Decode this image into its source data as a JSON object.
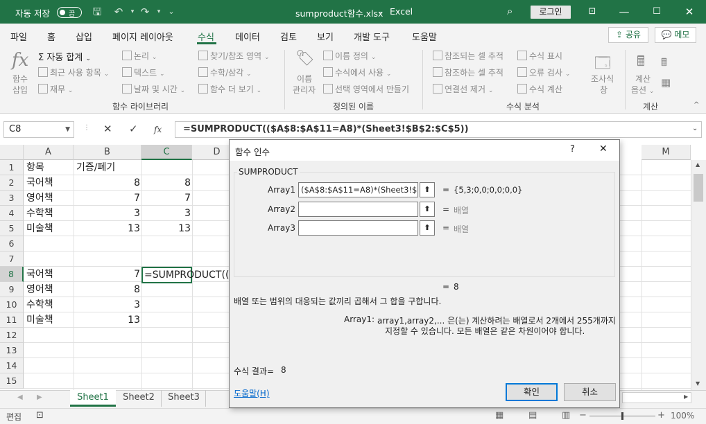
{
  "titlebar": {
    "autosave_label": "자동 저장",
    "autosave_state": "끔",
    "filename": "sumproduct함수.xlsx",
    "separator": "-",
    "app": "Excel",
    "login_label": "로그인",
    "bg_color": "#217346"
  },
  "menu": {
    "tabs": [
      "파일",
      "홈",
      "삽입",
      "페이지 레이아웃",
      "수식",
      "데이터",
      "검토",
      "보기",
      "개발 도구",
      "도움말"
    ],
    "active_tab": "수식",
    "share_label": "공유",
    "memo_label": "메모"
  },
  "ribbon": {
    "fx_label_1": "함수",
    "fx_label_2": "삽입",
    "autosum_label": "자동 합계",
    "recent_label": "최근 사용 항목",
    "finance_label": "재무",
    "logical_label": "논리",
    "text_label": "텍스트",
    "datetime_label": "날짜 및 시간",
    "lookup_label": "찾기/참조 영역",
    "math_label": "수학/삼각",
    "more_label": "함수 더 보기",
    "group1": "함수 라이브러리",
    "name_mgr_1": "이름",
    "name_mgr_2": "관리자",
    "define_name": "이름 정의",
    "use_in_formula": "수식에서 사용",
    "create_from_sel": "선택 영역에서 만들기",
    "group2": "정의된 이름",
    "trace_prec": "참조되는 셀 추적",
    "trace_dep": "참조하는 셀 추적",
    "remove_arrows": "연결선 제거",
    "show_formulas": "수식 표시",
    "error_check": "오류 검사",
    "eval_formula": "수식 계산",
    "watch_1": "조사식",
    "watch_2": "창",
    "group3": "수식 분석",
    "calc_opt_1": "계산",
    "calc_opt_2": "옵션",
    "group4": "계산"
  },
  "formula_bar": {
    "name_box": "C8",
    "cancel_icon": "✕",
    "enter_icon": "✓",
    "fx_icon": "fx",
    "formula": "=SUMPRODUCT(($A$8:$A$11=A8)*(Sheet3!$B$2:$C$5))"
  },
  "grid": {
    "columns": [
      "A",
      "B",
      "C",
      "D",
      "E",
      "F",
      "G",
      "H",
      "I",
      "J",
      "K",
      "L",
      "M"
    ],
    "rows": [
      "1",
      "2",
      "3",
      "4",
      "5",
      "6",
      "7",
      "8",
      "9",
      "10",
      "11",
      "12",
      "13",
      "14",
      "15"
    ],
    "cells": {
      "A1": "항목",
      "B1": "기증/폐기",
      "A2": "국어책",
      "B2": "8",
      "C2": "8",
      "A3": "영어책",
      "B3": "7",
      "C3": "7",
      "A4": "수학책",
      "B4": "3",
      "C4": "3",
      "A5": "미술책",
      "B5": "13",
      "C5": "13",
      "A8": "국어책",
      "B8": "7",
      "C8": "=SUMPRODUCT((",
      "A9": "영어책",
      "B9": "8",
      "A10": "수학책",
      "B10": "3",
      "A11": "미술책",
      "B11": "13"
    }
  },
  "sheets": {
    "tabs": [
      "Sheet1",
      "Sheet2",
      "Sheet3"
    ],
    "active": "Sheet1"
  },
  "status": {
    "mode": "편집",
    "zoom": "100%"
  },
  "dialog": {
    "title": "함수 인수",
    "help_glyph": "?",
    "close_glyph": "✕",
    "function_name": "SUMPRODUCT",
    "args": [
      {
        "label": "Array1",
        "value": "($A$8:$A$11=A8)*(Sheet3!$B$2:$C$5)",
        "result": "{5,3;0,0;0,0;0,0}"
      },
      {
        "label": "Array2",
        "value": "",
        "result": "배열"
      },
      {
        "label": "Array3",
        "value": "",
        "result": "배열"
      }
    ],
    "equals": "=",
    "overall_result": "8",
    "description": "배열 또는 범위의 대응되는 값끼리 곱해서 그 합을 구합니다.",
    "arg_desc_label": "Array1:",
    "arg_desc_line1": "array1,array2,... 은(는) 계산하려는 배열로서 2개에서 255개까지",
    "arg_desc_line2": "지정할 수 있습니다. 모든 배열은 같은 차원이어야 합니다.",
    "formula_result_label": "수식 결과=",
    "formula_result": "8",
    "help_link": "도움말(H)",
    "ok_label": "확인",
    "cancel_label": "취소"
  }
}
